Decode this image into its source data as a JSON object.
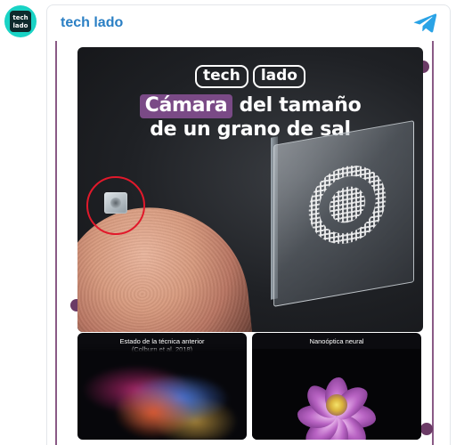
{
  "channel": {
    "name": "tech lado",
    "avatar_line1": "tech",
    "avatar_line2": "lado",
    "telegram_icon": "telegram-icon"
  },
  "post_image": {
    "logo_left": "tech",
    "logo_right": "lado",
    "headline_accent": "Cámara",
    "headline_rest_line1": " del tamaño",
    "headline_line2": "de un grano de sal",
    "panel_left_caption_line1": "Estado de la técnica anterior",
    "panel_left_caption_line2": "(Colburn et al. 2018)",
    "panel_right_caption": "Nanoóptica neural"
  },
  "colors": {
    "accent": "#2a7fc4",
    "highlight": "#7a4a86",
    "frame": "#8a5a86",
    "dot": "#6b3b66",
    "avatar_bg": "#19d3c5",
    "red_circle": "#e1192b"
  }
}
